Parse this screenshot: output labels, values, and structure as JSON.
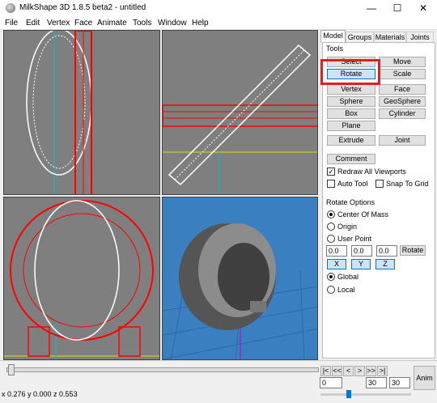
{
  "window": {
    "title": "MilkShape 3D 1.8.5 beta2 - untitled",
    "minimize": "—",
    "maximize": "☐",
    "close": "✕"
  },
  "menu": [
    "File",
    "Edit",
    "Vertex",
    "Face",
    "Animate",
    "Tools",
    "Window",
    "Help"
  ],
  "tabs": [
    "Model",
    "Groups",
    "Materials",
    "Joints"
  ],
  "tools": {
    "group_label": "Tools",
    "buttons": [
      "Select",
      "Move",
      "Rotate",
      "Scale",
      "Vertex",
      "Face",
      "Sphere",
      "GeoSphere",
      "Box",
      "Cylinder",
      "Plane",
      "Extrude",
      "Joint",
      "Comment"
    ],
    "active": "Rotate",
    "checkboxes": [
      {
        "label": "Redraw All Viewports",
        "checked": true
      },
      {
        "label": "Auto Tool",
        "checked": false
      },
      {
        "label": "Snap To Grid",
        "checked": false
      }
    ]
  },
  "rotate_options": {
    "label": "Rotate Options",
    "radios": [
      {
        "label": "Center Of Mass",
        "selected": true
      },
      {
        "label": "Origin",
        "selected": false
      },
      {
        "label": "User Point",
        "selected": false
      }
    ],
    "x": "0.0",
    "y": "0.0",
    "z": "0.0",
    "rotate_button": "Rotate",
    "axis_buttons": [
      "X",
      "Y",
      "Z"
    ],
    "space": [
      {
        "label": "Global",
        "selected": true
      },
      {
        "label": "Local",
        "selected": false
      }
    ]
  },
  "timeline": {
    "status": "x 0.276 y 0.000 z 0.553",
    "frame": "0",
    "frame_end": "30",
    "total_frames": "30",
    "anim_label": "Anim",
    "nav": [
      "|<",
      "<<",
      "<",
      ">",
      ">>",
      ">|"
    ]
  },
  "colors": {
    "wire_white": "#ffffff",
    "wire_red": "#ff0000",
    "viewport_gray": "#7f7f7f",
    "viewport_3d": "#3a7fc0",
    "highlight": "#e02020"
  }
}
